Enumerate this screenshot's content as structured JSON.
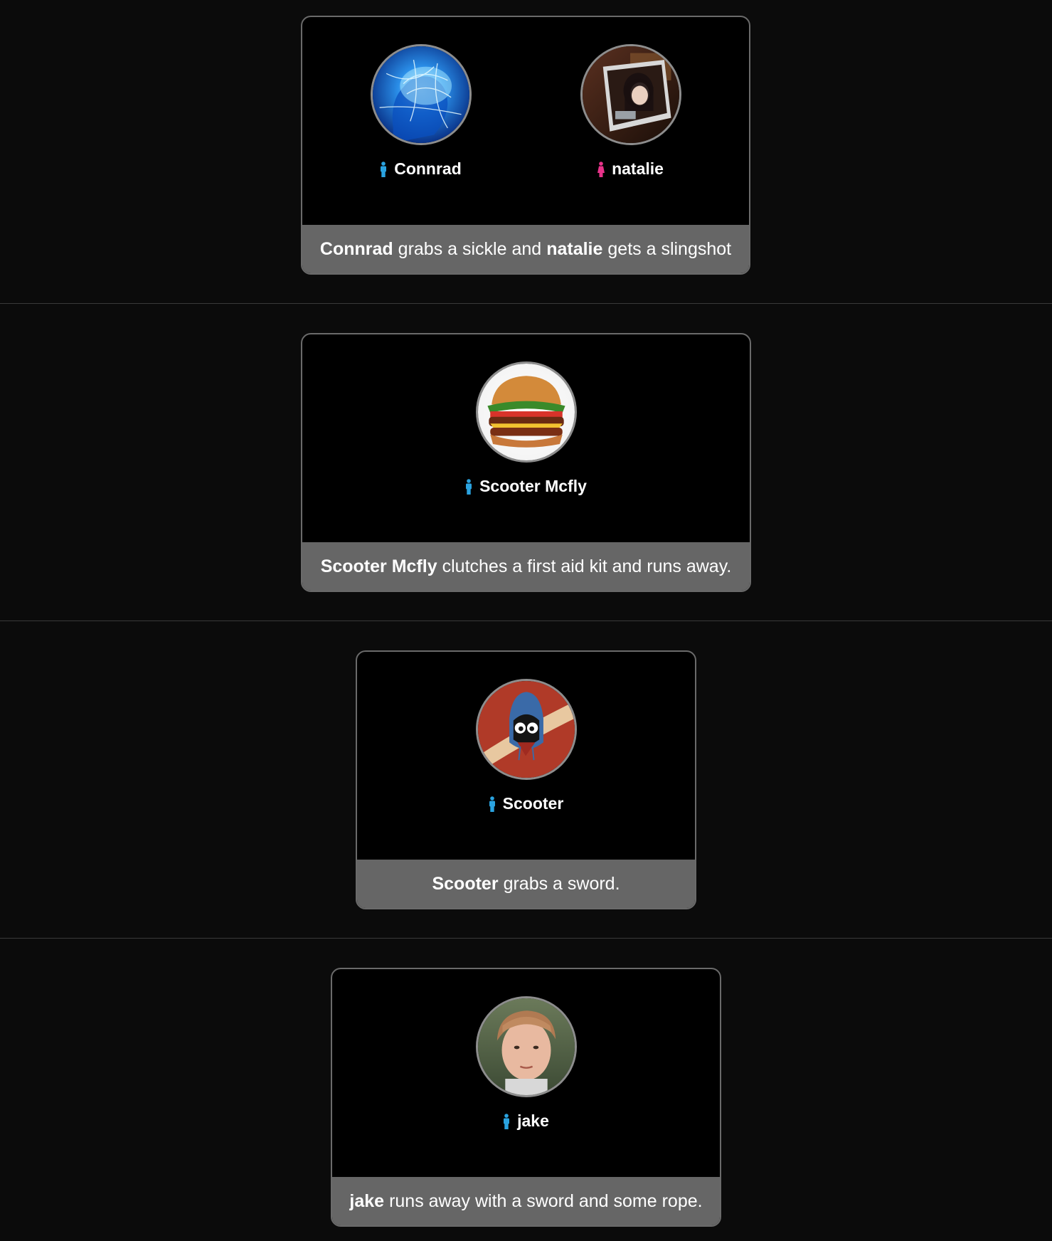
{
  "colors": {
    "male": "#2aa3e0",
    "female": "#e8338a",
    "card_border": "#6a6a6a",
    "caption_bg": "#666666"
  },
  "events": [
    {
      "players": [
        {
          "name": "Connrad",
          "gender_icon": "male-icon",
          "avatar": "glowing-brain-avatar"
        },
        {
          "name": "natalie",
          "gender_icon": "female-icon",
          "avatar": "girl-photo-avatar"
        }
      ],
      "caption": {
        "name1": "Connrad",
        "text1": "grabs a sickle and",
        "name2": "natalie",
        "text2": "gets a slingshot"
      }
    },
    {
      "players": [
        {
          "name": "Scooter Mcfly",
          "gender_icon": "male-icon",
          "avatar": "burger-avatar"
        }
      ],
      "caption": {
        "name1": "Scooter Mcfly",
        "text1": "clutches a first aid kit and runs away."
      }
    },
    {
      "players": [
        {
          "name": "Scooter",
          "gender_icon": "male-icon",
          "avatar": "hooded-cartoon-avatar"
        }
      ],
      "caption": {
        "name1": "Scooter",
        "text1": "grabs a sword."
      }
    },
    {
      "players": [
        {
          "name": "jake",
          "gender_icon": "male-icon",
          "avatar": "boy-photo-avatar"
        }
      ],
      "caption": {
        "name1": "jake",
        "text1": "runs away with a sword and some rope."
      }
    }
  ]
}
